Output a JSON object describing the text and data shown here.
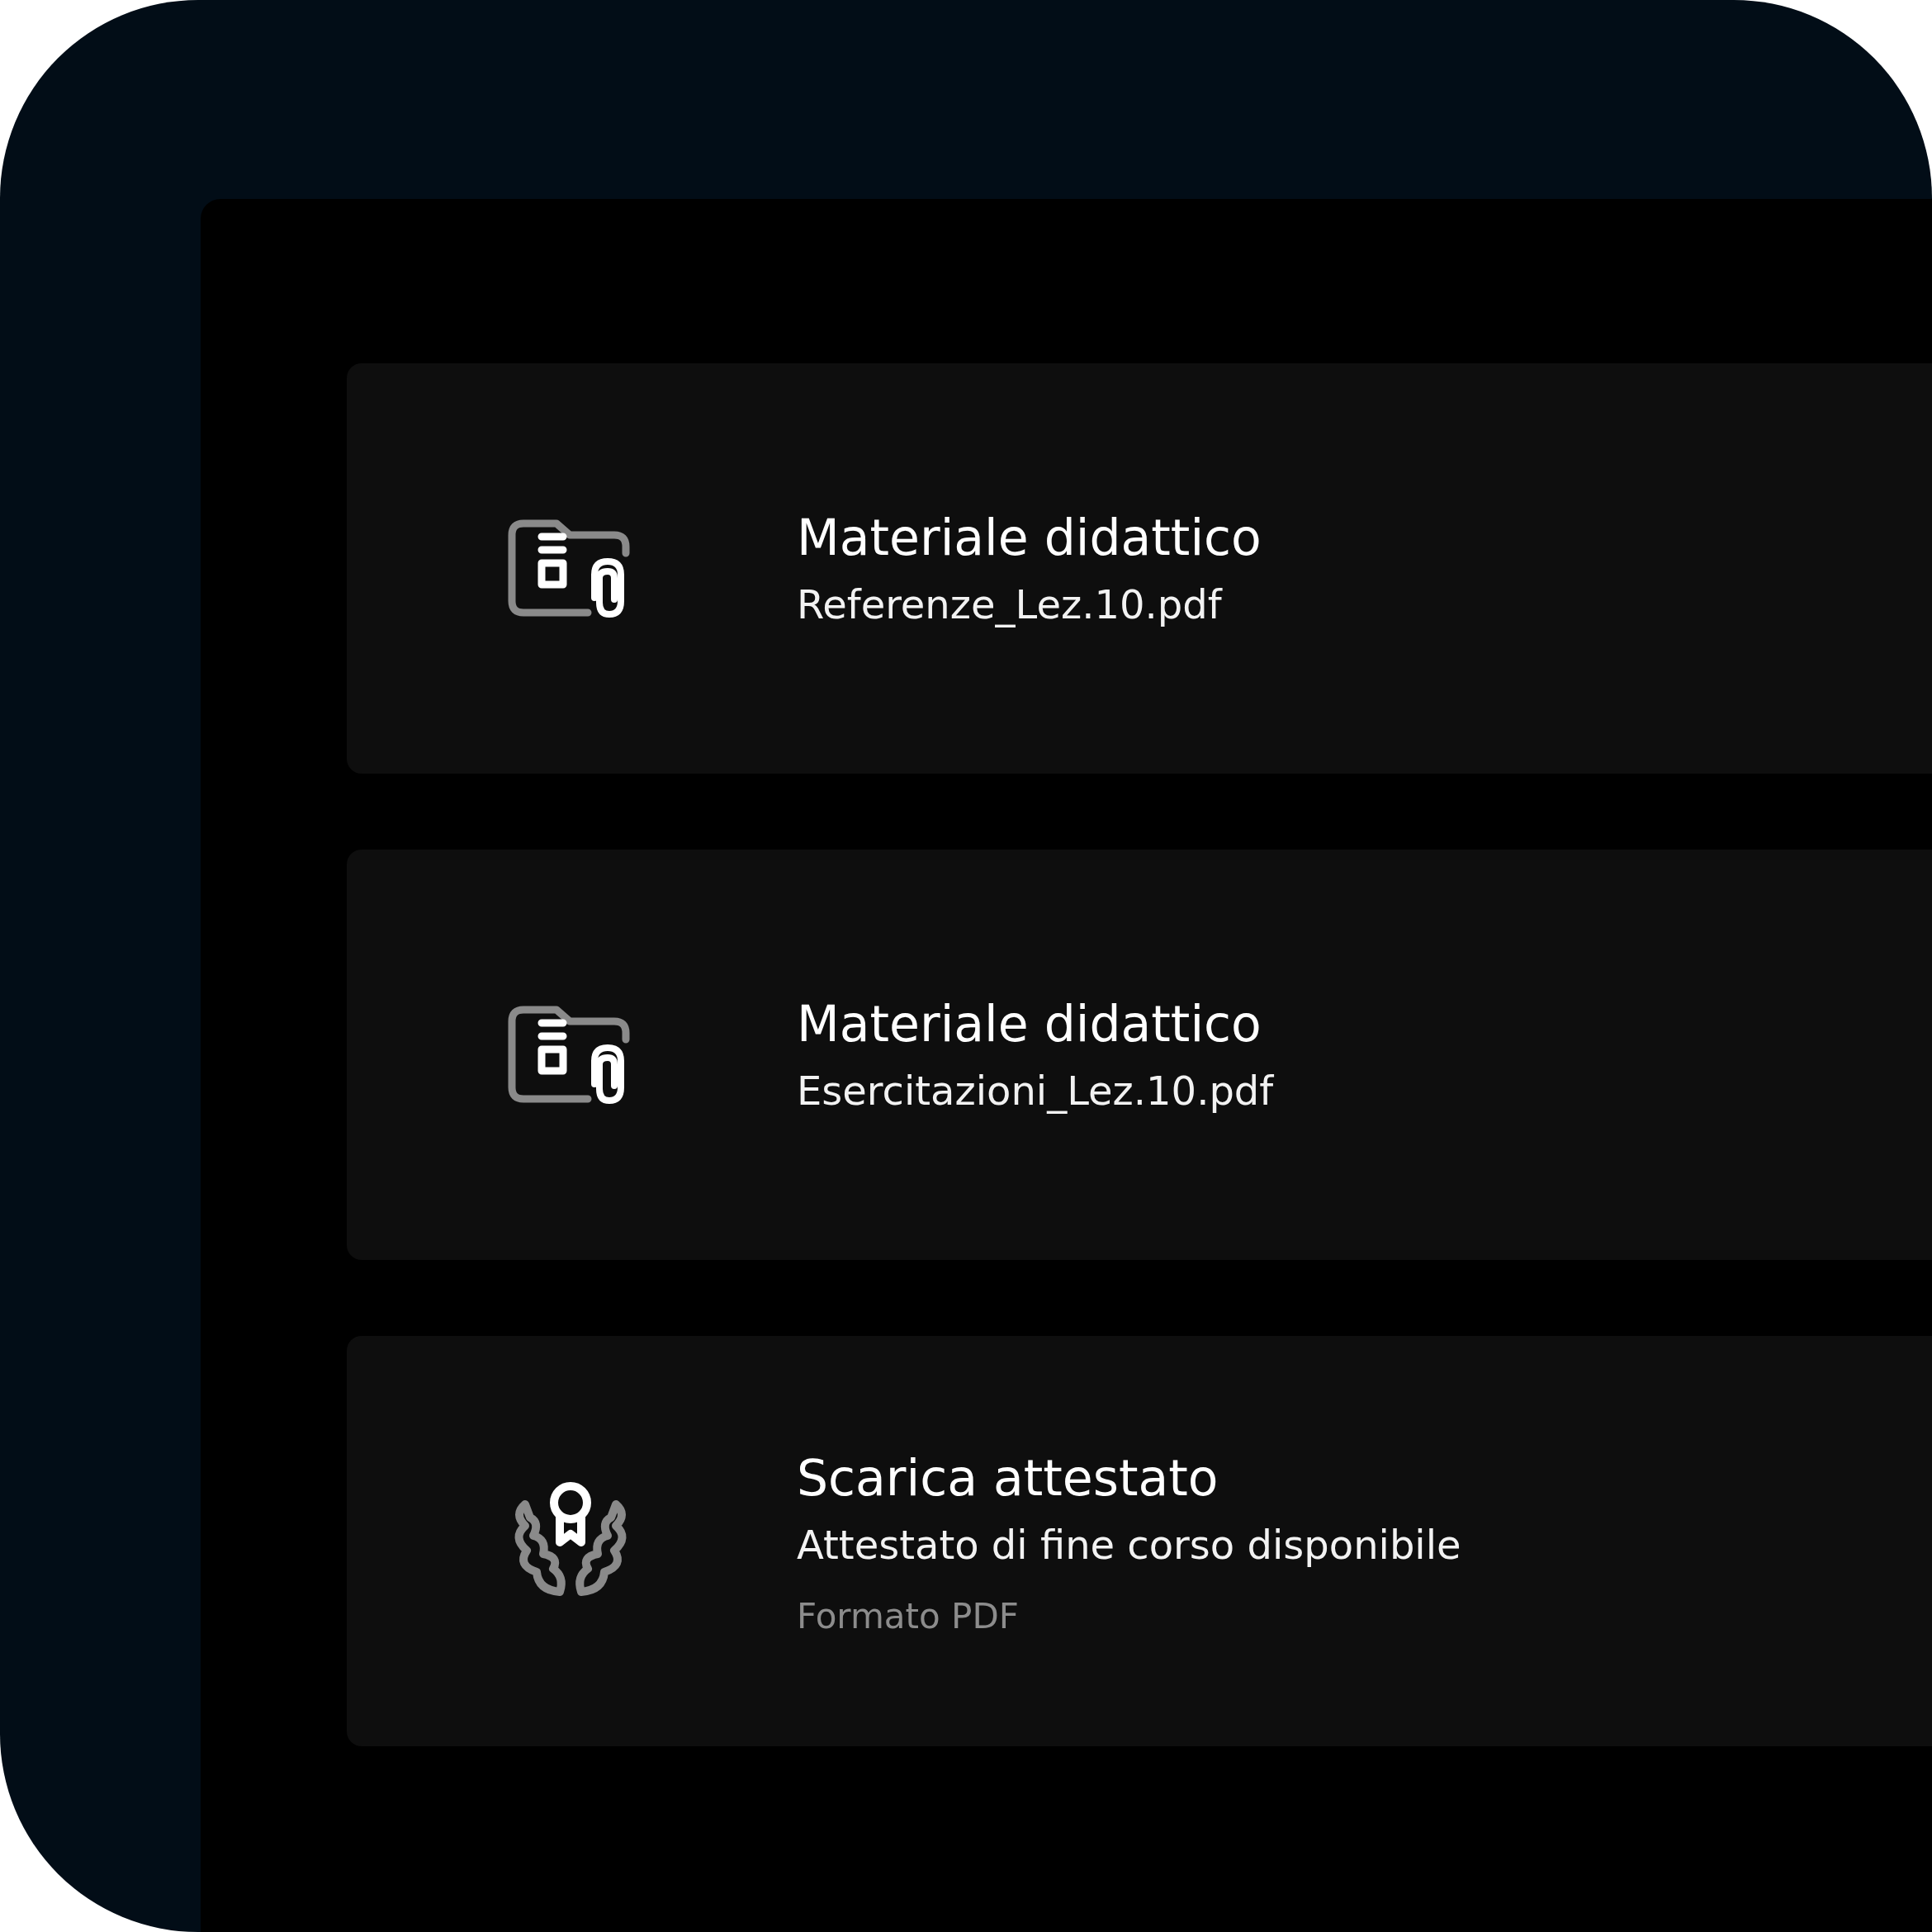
{
  "items": [
    {
      "kind": "folder",
      "title": "Materiale didattico",
      "subtitle": "Referenze_Lez.10.pdf"
    },
    {
      "kind": "folder",
      "title": "Materiale didattico",
      "subtitle": "Esercitazioni_Lez.10.pdf"
    },
    {
      "kind": "award",
      "title": "Scarica attestato",
      "subtitle": "Attestato di fine corso disponibile",
      "note": "Formato PDF"
    }
  ]
}
